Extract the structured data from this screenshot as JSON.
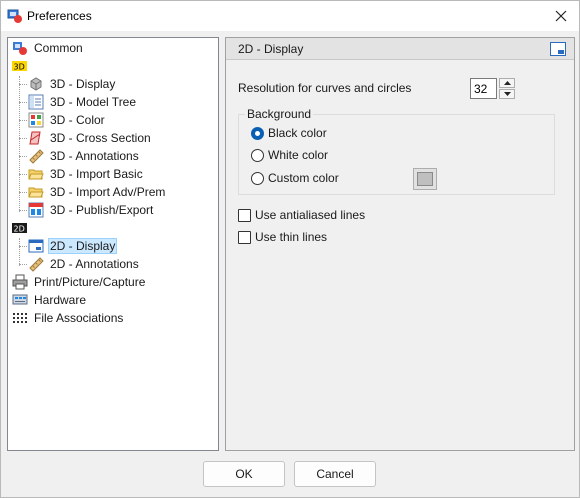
{
  "window": {
    "title": "Preferences"
  },
  "tree": {
    "items": [
      {
        "label": "Common",
        "icon": "common-settings-icon"
      },
      {
        "label": "3D",
        "icon": "3d-category-icon",
        "badge": true
      },
      {
        "label": "3D - Display",
        "icon": "cube-icon"
      },
      {
        "label": "3D - Model Tree",
        "icon": "model-tree-icon"
      },
      {
        "label": "3D - Color",
        "icon": "color-palette-icon"
      },
      {
        "label": "3D - Cross Section",
        "icon": "cross-section-icon"
      },
      {
        "label": "3D - Annotations",
        "icon": "ruler-icon"
      },
      {
        "label": "3D - Import Basic",
        "icon": "folder-open-icon"
      },
      {
        "label": "3D - Import Adv/Prem",
        "icon": "folder-open-icon"
      },
      {
        "label": "3D - Publish/Export",
        "icon": "publish-icon"
      },
      {
        "label": "2D",
        "icon": "2d-category-icon",
        "badge": true
      },
      {
        "label": "2D - Display",
        "icon": "display-window-icon",
        "selected": true
      },
      {
        "label": "2D - Annotations",
        "icon": "ruler-icon"
      },
      {
        "label": "Print/Picture/Capture",
        "icon": "printer-icon"
      },
      {
        "label": "Hardware",
        "icon": "hardware-icon"
      },
      {
        "label": "File Associations",
        "icon": "file-associations-icon"
      }
    ]
  },
  "panel": {
    "title": "2D - Display",
    "resolution_label": "Resolution for curves and circles",
    "resolution_value": "32",
    "background": {
      "legend": "Background",
      "options": [
        {
          "label": "Black color",
          "checked": true
        },
        {
          "label": "White color",
          "checked": false
        },
        {
          "label": "Custom color",
          "checked": false
        }
      ],
      "custom_swatch": "#bfbfbf"
    },
    "checkboxes": [
      {
        "label": "Use antialiased lines",
        "checked": false
      },
      {
        "label": "Use thin lines",
        "checked": false
      }
    ]
  },
  "buttons": {
    "ok": "OK",
    "cancel": "Cancel"
  },
  "colors": {
    "accent": "#0a5fb4",
    "selection": "#cce8ff",
    "badge": "#ffd700"
  }
}
